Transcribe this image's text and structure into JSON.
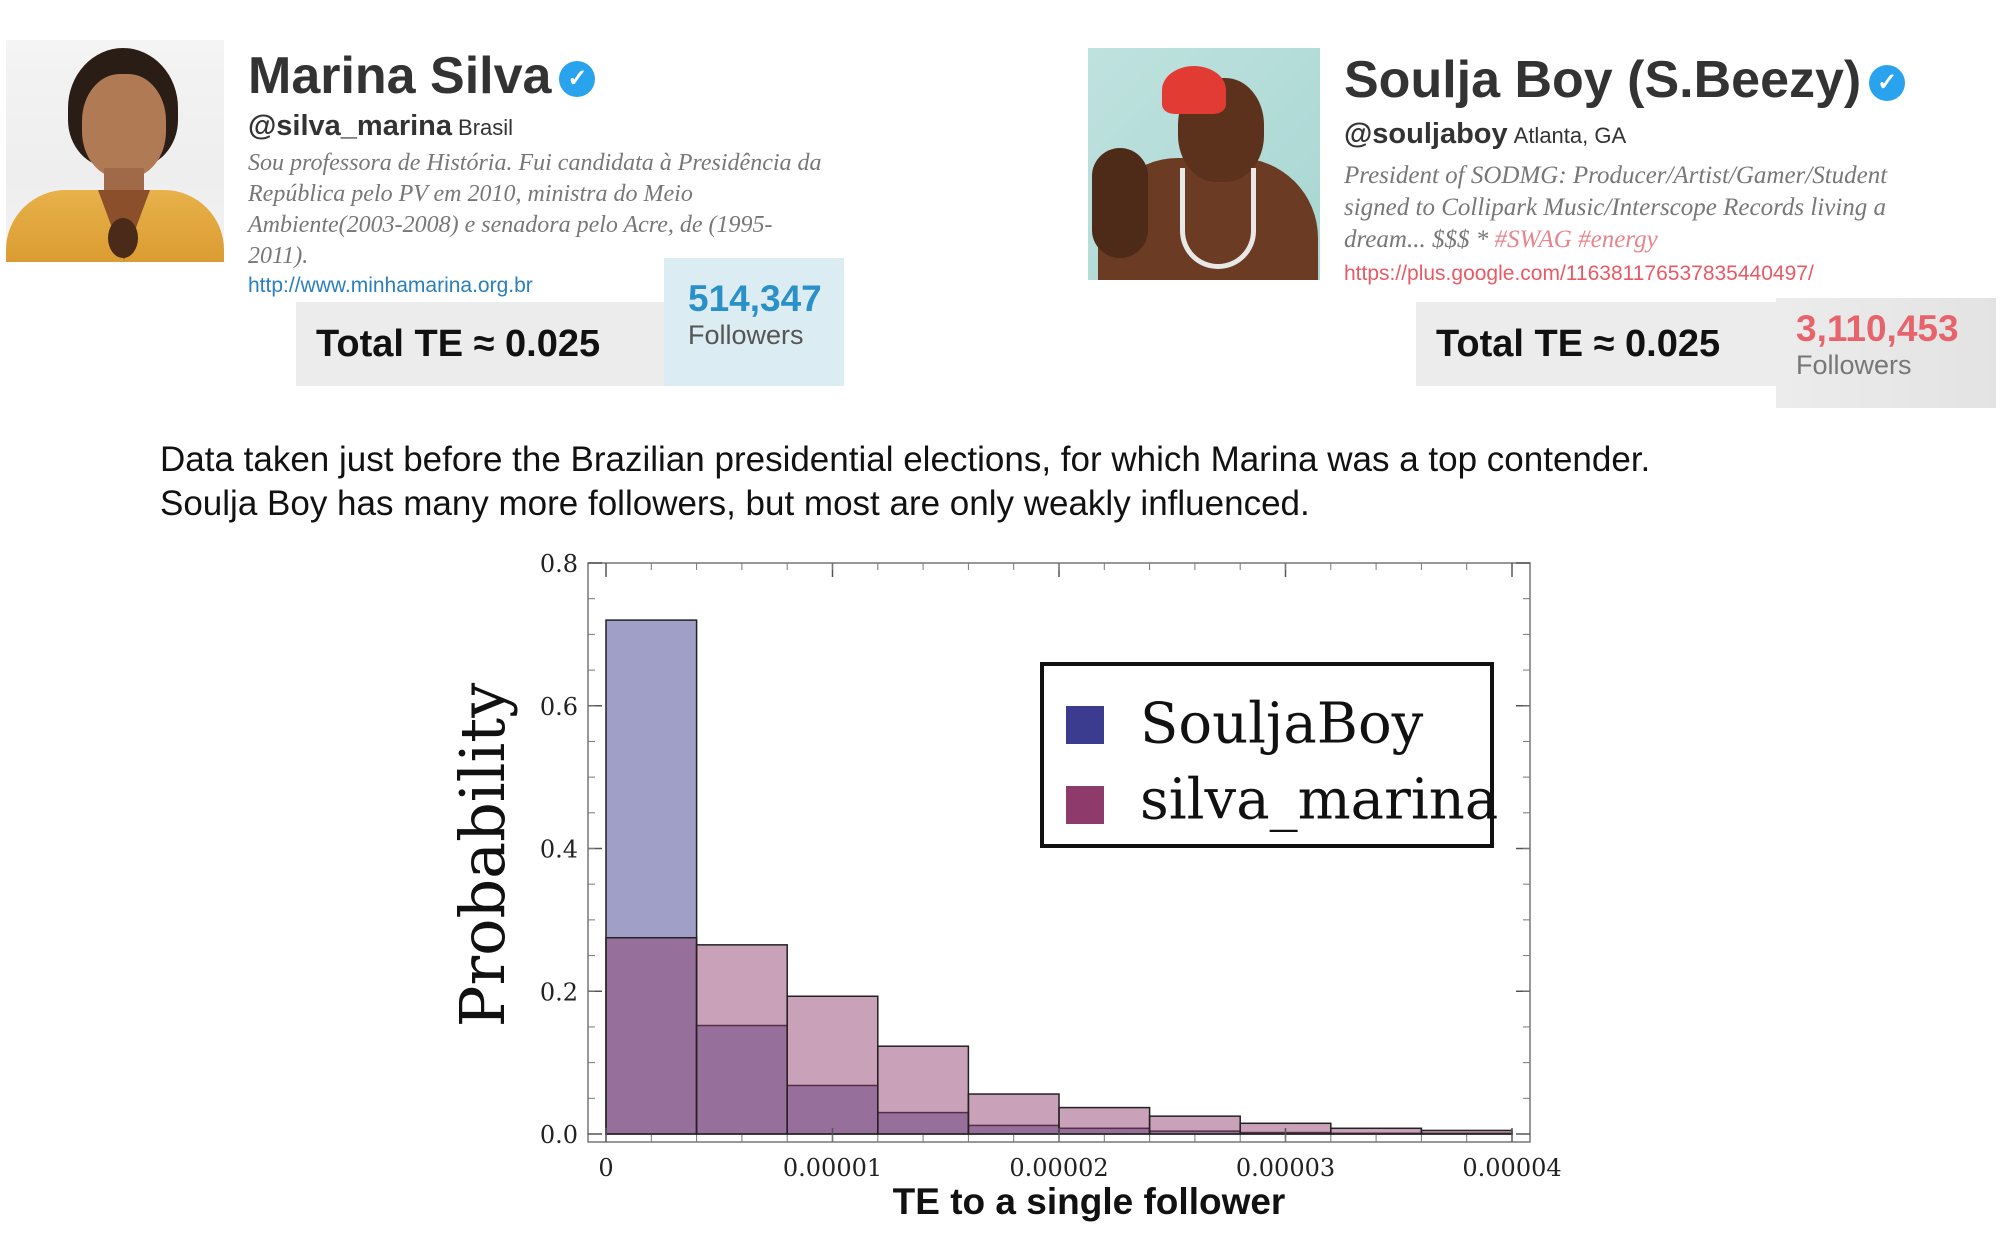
{
  "left_profile": {
    "name": "Marina Silva",
    "verified_icon": "verified-badge-icon",
    "handle": "@silva_marina",
    "location": "Brasil",
    "bio_lines": [
      "Sou professora de História. Fui candidata à Presidência da",
      "República pelo PV em 2010, ministra do Meio",
      "Ambiente(2003-2008) e senadora pelo Acre, de (1995-",
      "2011)."
    ],
    "url": "http://www.minhamarina.org.br",
    "total_te": "Total TE ≈ 0.025",
    "followers_count": "514,347",
    "followers_label": "Followers",
    "colors": {
      "followers_bg": "#dcecf3",
      "followers_count": "#2a90c8",
      "link": "#2a7fbf"
    }
  },
  "right_profile": {
    "name": "Soulja Boy (S.Beezy)",
    "verified_icon": "verified-badge-icon",
    "handle": "@souljaboy",
    "location": "Atlanta, GA",
    "bio_lines": [
      "President of SODMG: Producer/Artist/Gamer/Student",
      "signed to Collipark Music/Interscope Records living a"
    ],
    "bio_last_prefix": "dream... $$$ * ",
    "bio_hashtags": "#SWAG #energy",
    "url": "https://plus.google.com/116381176537835440497/",
    "total_te": "Total TE ≈ 0.025",
    "followers_count": "3,110,453",
    "followers_label": "Followers",
    "colors": {
      "followers_bg": "#e6e6e6",
      "followers_count": "#e8646c",
      "link": "#e85a64"
    }
  },
  "caption": {
    "line1": "Data taken just before the Brazilian presidential elections, for which Marina was a top contender.",
    "line2": "Soulja Boy has many more followers, but most are only weakly influenced."
  },
  "chart_data": {
    "type": "bar",
    "subtype": "overlaid histogram",
    "xlabel": "TE  to a single follower",
    "ylabel": "Probability",
    "xlim": [
      0,
      4e-05
    ],
    "ylim": [
      0,
      0.8
    ],
    "x_ticks": [
      "0",
      "0.00001",
      "0.00002",
      "0.00003",
      "0.00004"
    ],
    "y_ticks": [
      "0.0",
      "0.2",
      "0.4",
      "0.6",
      "0.8"
    ],
    "bin_edges": [
      0,
      4e-06,
      8e-06,
      1.2e-05,
      1.6e-05,
      2e-05,
      2.4e-05,
      2.8e-05,
      3.2e-05,
      3.6e-05,
      4e-05
    ],
    "series": [
      {
        "name": "SouljaBoy",
        "color": "#3b3b8f",
        "fill": "#a09fc7",
        "values": [
          0.72,
          0.152,
          0.068,
          0.03,
          0.012,
          0.008,
          0.004,
          0.002,
          0.001,
          0.001
        ]
      },
      {
        "name": "silva_marina",
        "color": "#8e3a6a",
        "fill": "#c89ab5",
        "values": [
          0.275,
          0.265,
          0.193,
          0.123,
          0.056,
          0.037,
          0.025,
          0.015,
          0.008,
          0.005
        ]
      }
    ],
    "overlap_fill": "#9c6b9b",
    "legend_position": "top-right",
    "grid": false
  }
}
